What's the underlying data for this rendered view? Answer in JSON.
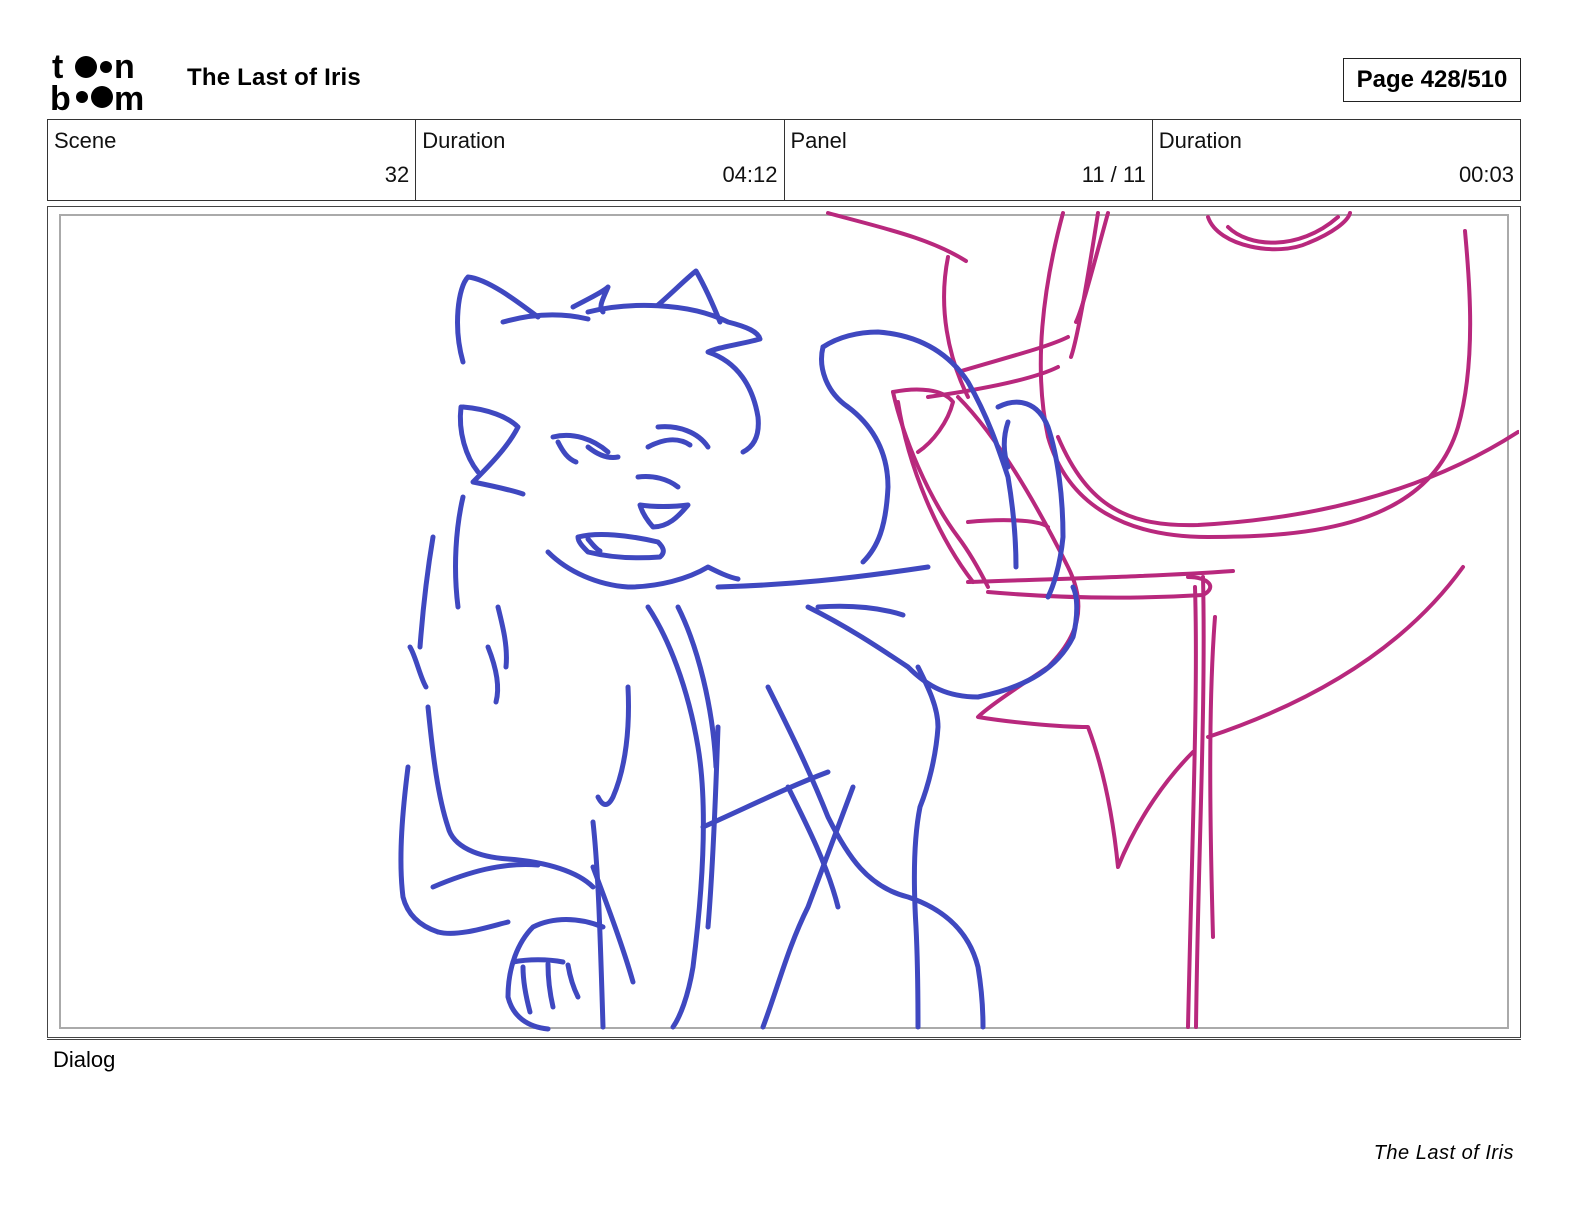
{
  "header": {
    "logo_text": "toon boom",
    "title": "The Last of Iris",
    "page_label": "Page 428/510"
  },
  "info": [
    {
      "label": "Scene",
      "value": "32"
    },
    {
      "label": "Duration",
      "value": "04:12"
    },
    {
      "label": "Panel",
      "value": "11 / 11"
    },
    {
      "label": "Duration",
      "value": "00:03"
    }
  ],
  "panel": {
    "sketch_colors": {
      "character": "#3f48c0",
      "background": "#b8287d"
    }
  },
  "dialog": {
    "label": "Dialog"
  },
  "footer": {
    "title": "The Last of Iris"
  }
}
